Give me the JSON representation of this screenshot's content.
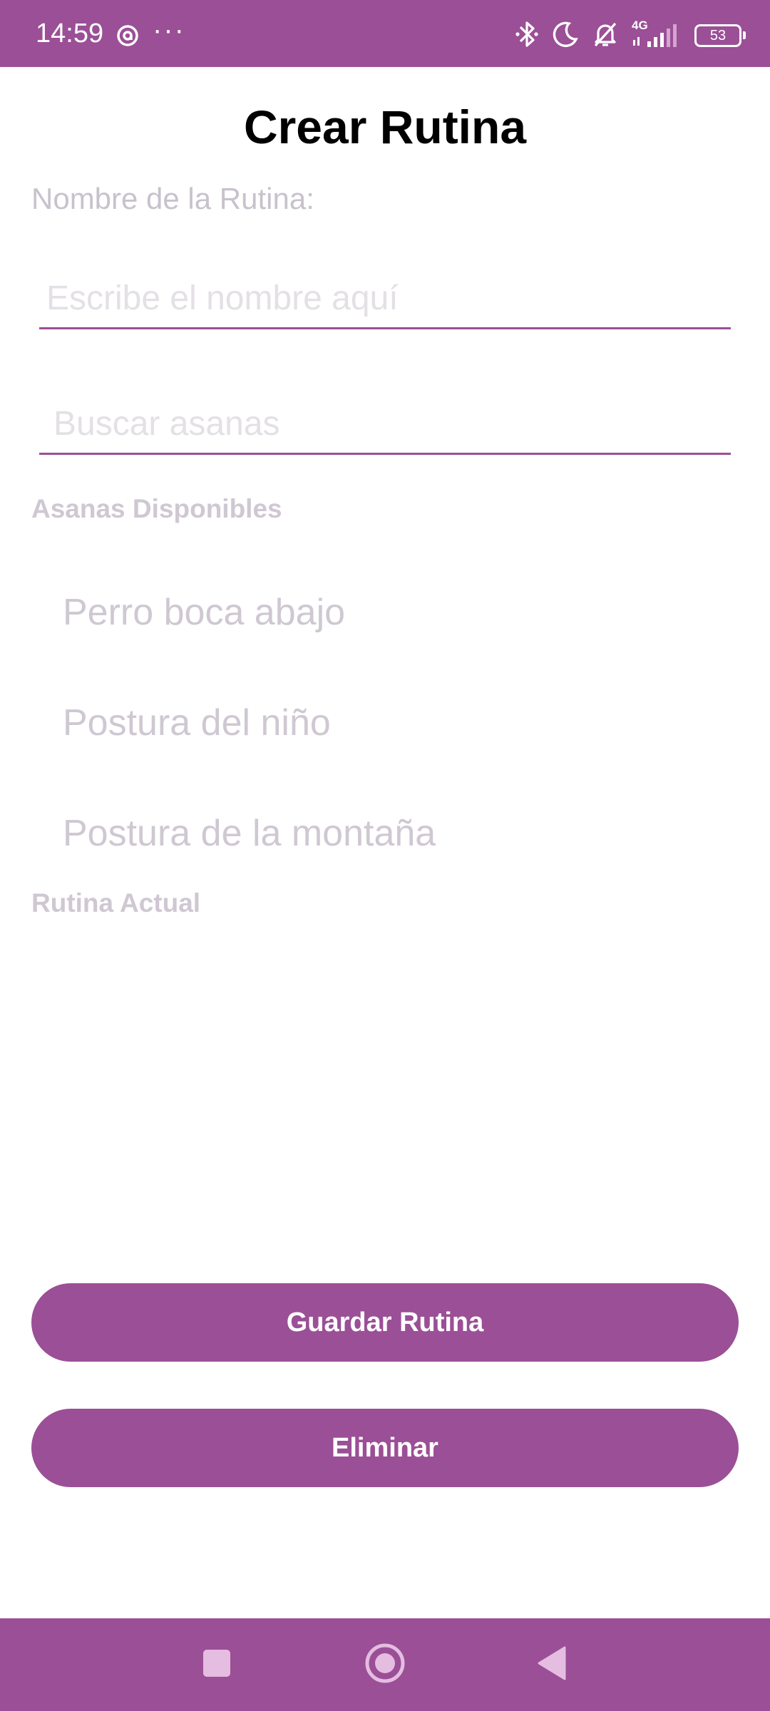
{
  "status_bar": {
    "time": "14:59",
    "more_indicator": "···",
    "battery_level": "53",
    "network_label": "4G",
    "icons": [
      "threads-icon",
      "bluetooth-icon",
      "do-not-disturb-moon-icon",
      "notifications-muted-icon",
      "signal-4g-icon",
      "battery-icon"
    ]
  },
  "header": {
    "title": "Crear Rutina"
  },
  "form": {
    "name_label": "Nombre de la Rutina:",
    "name_placeholder": "Escribe el nombre aquí",
    "name_value": "",
    "search_placeholder": "Buscar asanas",
    "search_value": ""
  },
  "available": {
    "title": "Asanas Disponibles",
    "items": [
      "Perro boca abajo",
      "Postura del niño",
      "Postura de la montaña"
    ]
  },
  "current_routine": {
    "title": "Rutina Actual",
    "items": []
  },
  "actions": {
    "save_label": "Guardar Rutina",
    "delete_label": "Eliminar"
  },
  "navigation": {
    "buttons": [
      "recents-square-icon",
      "home-circle-icon",
      "back-triangle-icon"
    ]
  },
  "colors": {
    "accent": "#9b4f96",
    "muted_text": "#cfc8d3",
    "title_text": "#000000"
  }
}
